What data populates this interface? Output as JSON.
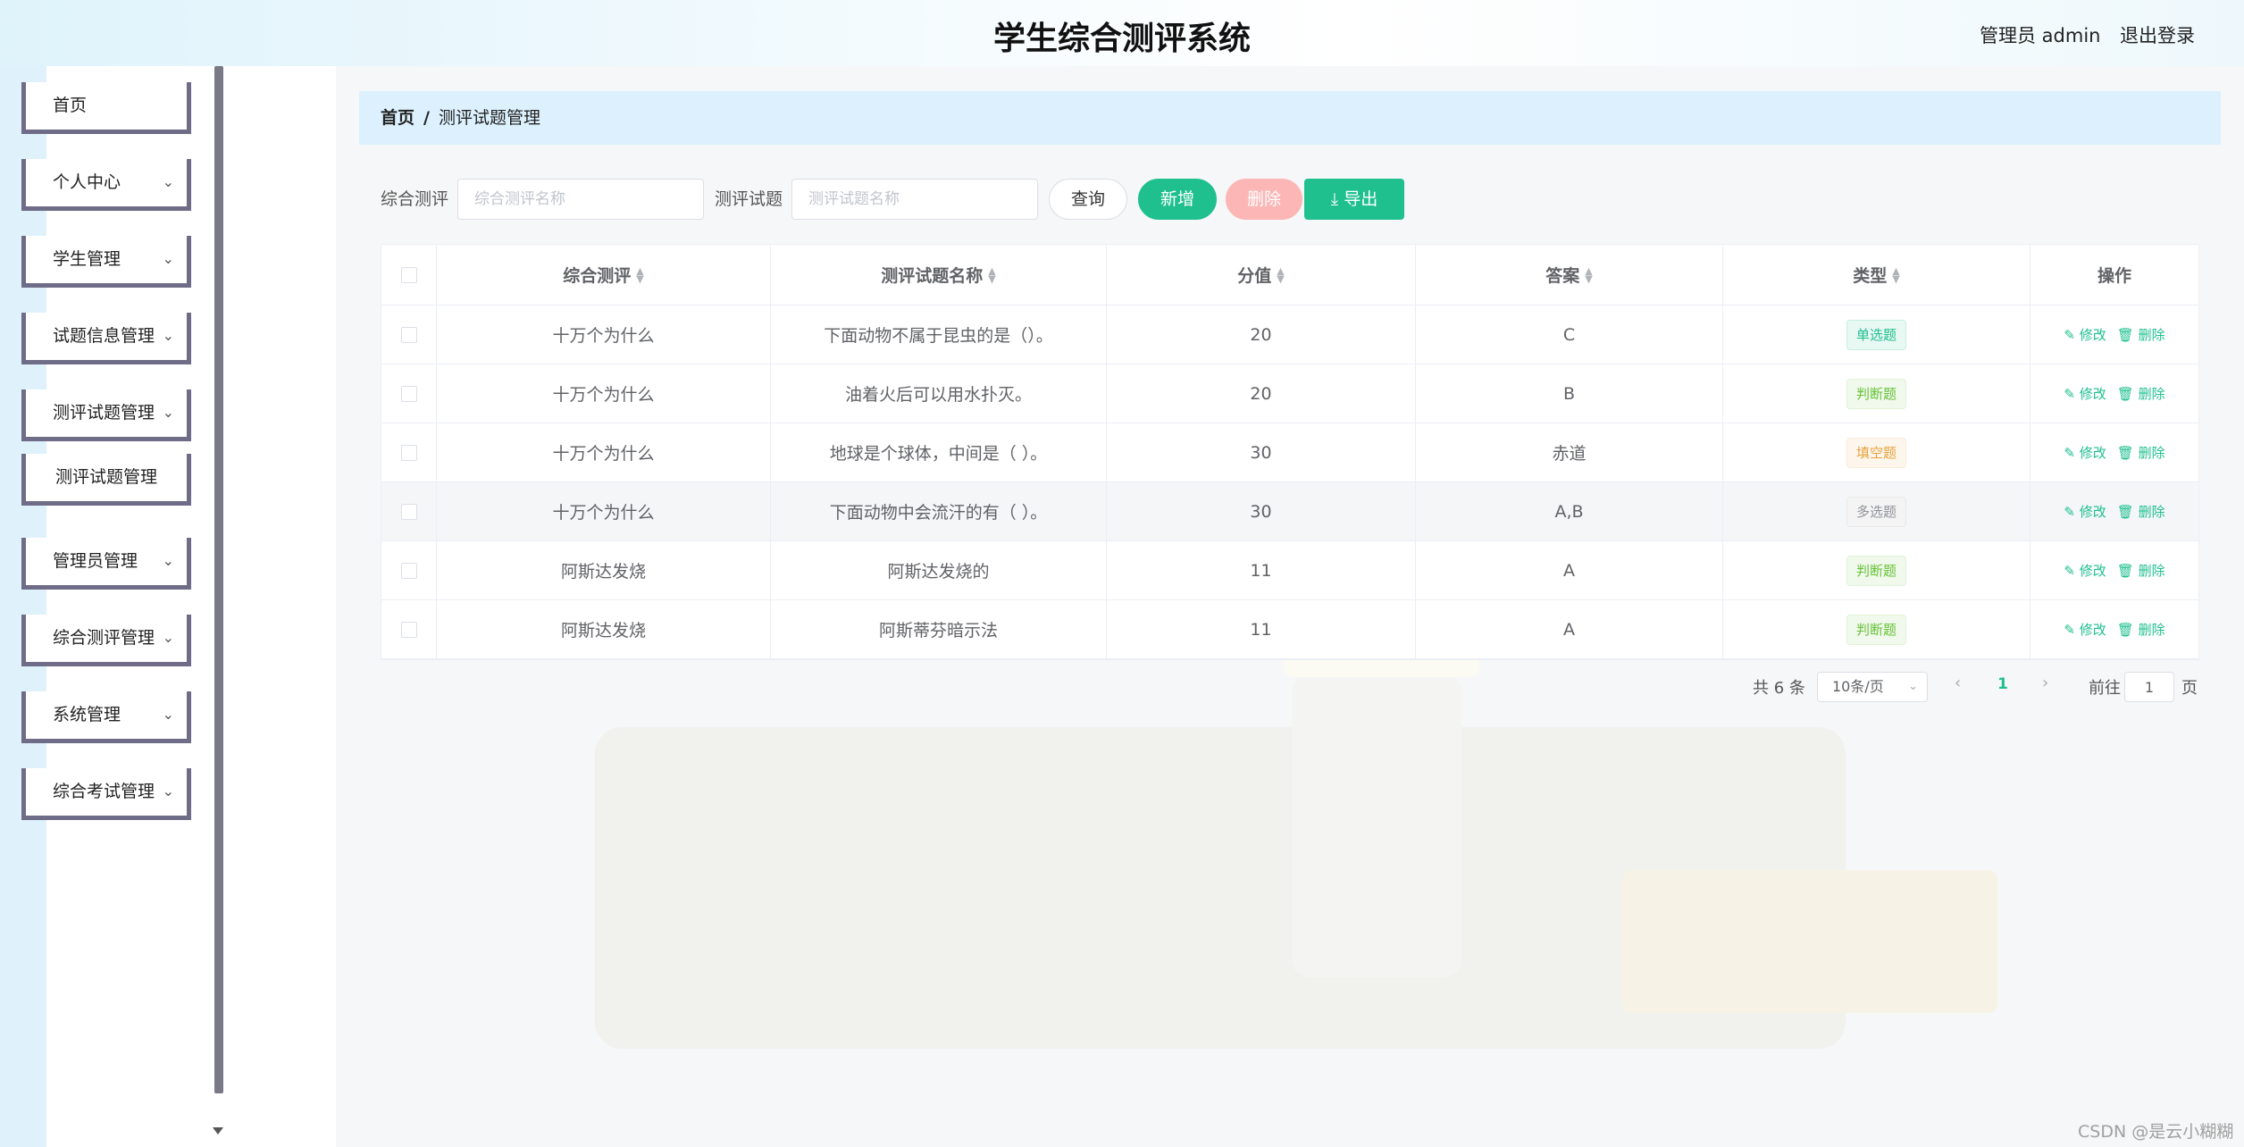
{
  "header": {
    "title": "学生综合测评系统",
    "user": "管理员 admin",
    "logout": "退出登录"
  },
  "sidebar": {
    "items": [
      {
        "label": "首页",
        "has_chevron": false
      },
      {
        "label": "个人中心",
        "has_chevron": true
      },
      {
        "label": "学生管理",
        "has_chevron": true
      },
      {
        "label": "试题信息管理",
        "has_chevron": true
      },
      {
        "label": "测评试题管理",
        "has_chevron": true
      },
      {
        "label": "测评试题管理",
        "has_chevron": false,
        "sub": true
      },
      {
        "label": "管理员管理",
        "has_chevron": true
      },
      {
        "label": "综合测评管理",
        "has_chevron": true
      },
      {
        "label": "系统管理",
        "has_chevron": true
      },
      {
        "label": "综合考试管理",
        "has_chevron": true
      }
    ]
  },
  "breadcrumb": {
    "home": "首页",
    "separator": "/",
    "current": "测评试题管理"
  },
  "search": {
    "label1": "综合测评",
    "placeholder1": "综合测评名称",
    "label2": "测评试题",
    "placeholder2": "测评试题名称",
    "query": "查询",
    "add": "新增",
    "delete": "删除",
    "export": "导出"
  },
  "table": {
    "headers": [
      "综合测评",
      "测评试题名称",
      "分值",
      "答案",
      "类型",
      "操作"
    ],
    "rows": [
      {
        "eval": "十万个为什么",
        "name": "下面动物不属于昆虫的是（）。",
        "score": "20",
        "answer": "C",
        "type": "单选题"
      },
      {
        "eval": "十万个为什么",
        "name": "油着火后可以用水扑灭。",
        "score": "20",
        "answer": "B",
        "type": "判断题"
      },
      {
        "eval": "十万个为什么",
        "name": "地球是个球体，中间是（ ）。",
        "score": "30",
        "answer": "赤道",
        "type": "填空题"
      },
      {
        "eval": "十万个为什么",
        "name": "下面动物中会流汗的有（ ）。",
        "score": "30",
        "answer": "A,B",
        "type": "多选题"
      },
      {
        "eval": "阿斯达发烧",
        "name": "阿斯达发烧的",
        "score": "11",
        "answer": "A",
        "type": "判断题"
      },
      {
        "eval": "阿斯达发烧",
        "name": "阿斯蒂芬暗示法",
        "score": "11",
        "answer": "A",
        "type": "判断题"
      }
    ],
    "edit": "修改",
    "remove": "删除"
  },
  "pagination": {
    "total": "共 6 条",
    "page_size": "10条/页",
    "current_page": "1",
    "goto_label": "前往",
    "goto_value": "1",
    "unit": "页"
  },
  "watermark": "CSDN @是云小糊糊",
  "colors": {
    "accent": "#1fc08e",
    "danger_light": "#fcb6b6",
    "breadcrumb_bg": "#dcf1fd",
    "menu_border": "#6f6c87"
  }
}
